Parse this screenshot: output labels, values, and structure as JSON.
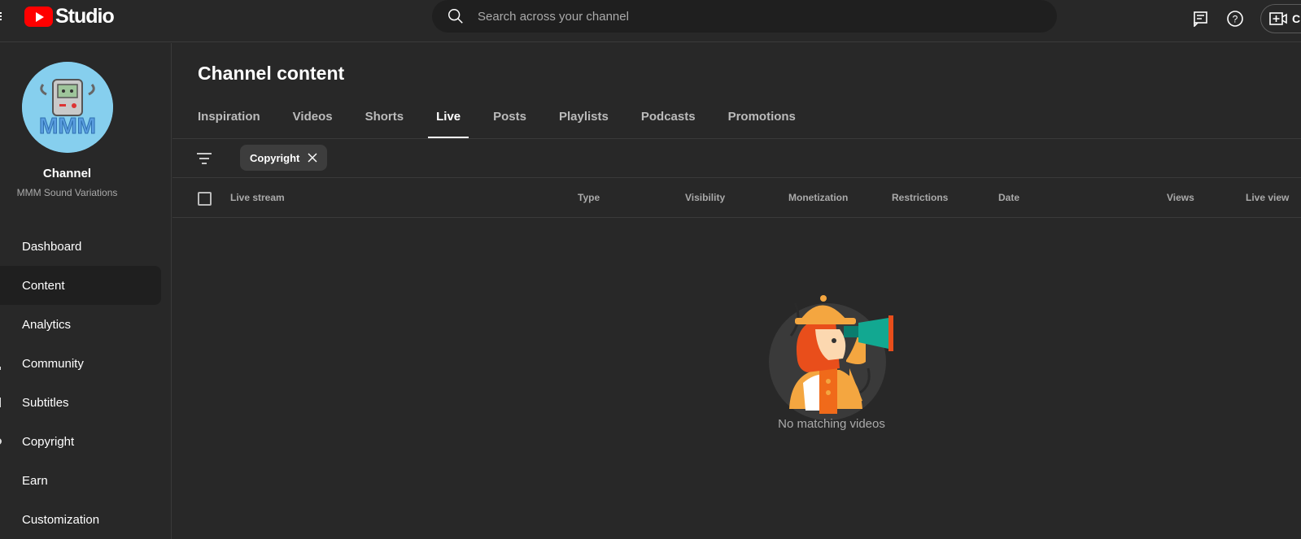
{
  "app": {
    "logo_text": "Studio"
  },
  "search": {
    "placeholder": "Search across your channel"
  },
  "topbar": {
    "create_label": "Cr"
  },
  "channel": {
    "title": "Channel",
    "name": "MMM Sound Variations",
    "avatar_text": "MMM"
  },
  "sidebar": {
    "items": [
      {
        "label": "Dashboard"
      },
      {
        "label": "Content",
        "active": true
      },
      {
        "label": "Analytics"
      },
      {
        "label": "Community"
      },
      {
        "label": "Subtitles"
      },
      {
        "label": "Copyright"
      },
      {
        "label": "Earn"
      },
      {
        "label": "Customization"
      }
    ]
  },
  "main": {
    "title": "Channel content",
    "tabs": [
      {
        "label": "Inspiration"
      },
      {
        "label": "Videos"
      },
      {
        "label": "Shorts"
      },
      {
        "label": "Live",
        "active": true
      },
      {
        "label": "Posts"
      },
      {
        "label": "Playlists"
      },
      {
        "label": "Podcasts"
      },
      {
        "label": "Promotions"
      }
    ],
    "filter_chip": "Copyright",
    "columns": [
      "Live stream",
      "Type",
      "Visibility",
      "Monetization",
      "Restrictions",
      "Date",
      "Views",
      "Live view"
    ],
    "empty_message": "No matching videos"
  },
  "colors": {
    "accent": "#ff0000",
    "background": "#282828",
    "search_bg": "#1f1f1f"
  }
}
